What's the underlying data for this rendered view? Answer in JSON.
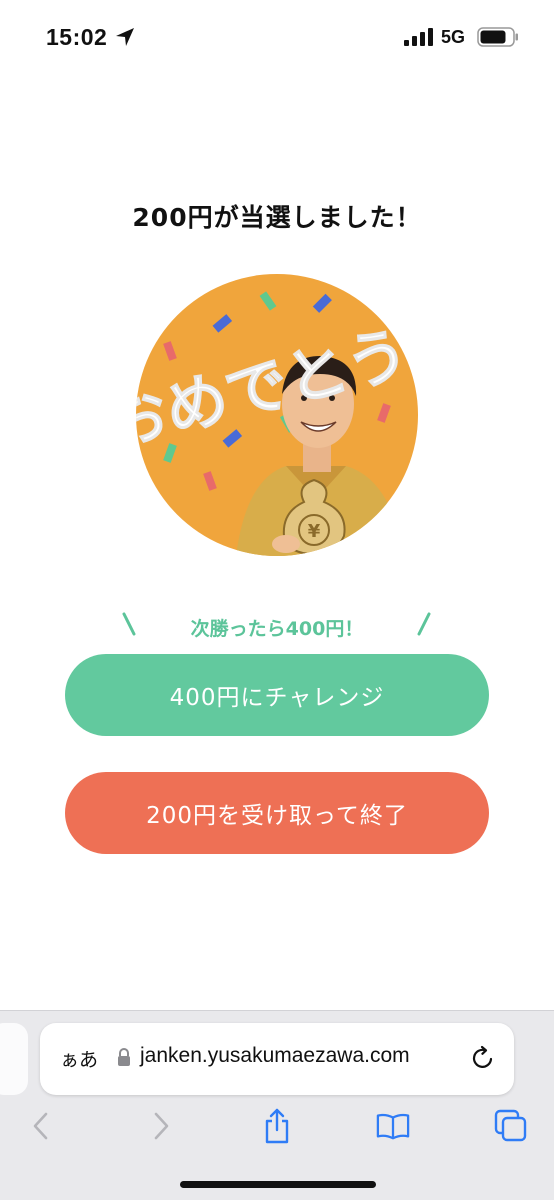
{
  "status_bar": {
    "time": "15:02",
    "network": "5G",
    "icons": [
      "location-arrow-icon",
      "signal-bars-icon",
      "battery-icon"
    ]
  },
  "main": {
    "title": "200円が当選しました！",
    "illustration_text": "おめでとう",
    "next_prompt": "次勝ったら400円！",
    "challenge_button": "400円にチャレンジ",
    "take_button": "200円を受け取って終了"
  },
  "browser": {
    "aa_label": "ぁあ",
    "url": "janken.yusakumaezawa.com",
    "toolbar_icons": [
      "back-icon",
      "forward-icon",
      "share-icon",
      "bookmarks-icon",
      "tabs-icon"
    ]
  },
  "colors": {
    "challenge": "#62c99e",
    "take": "#ee7055",
    "circle": "#f0a53c",
    "safari_blue": "#2f7cf6"
  }
}
